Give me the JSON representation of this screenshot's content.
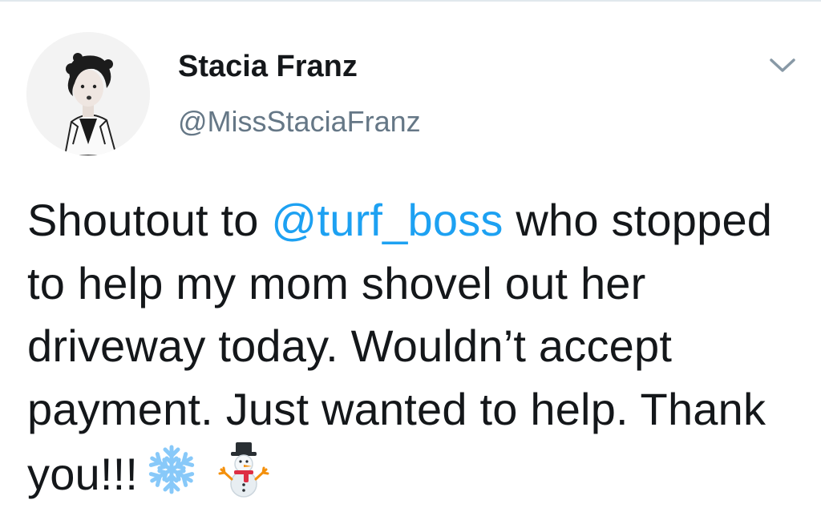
{
  "tweet": {
    "author": {
      "display_name": "Stacia Franz",
      "handle": "@MissStaciaFranz"
    },
    "menu_icon": "chevron-down-icon",
    "text_before_mention": "Shoutout to ",
    "mention": "@turf_boss",
    "text_after_mention": " who stopped to help my mom shovel out her driveway today. Wouldn’t accept payment. Just wanted to help. Thank you!!!",
    "emojis": [
      "snowflake-icon",
      "snowman-icon"
    ]
  },
  "colors": {
    "mention": "#1da1f2",
    "handle": "#657786",
    "text": "#14171a",
    "snowflake": "#88c9f9",
    "snowman_scarf": "#dd2e44",
    "snowman_arms": "#f4900c"
  }
}
